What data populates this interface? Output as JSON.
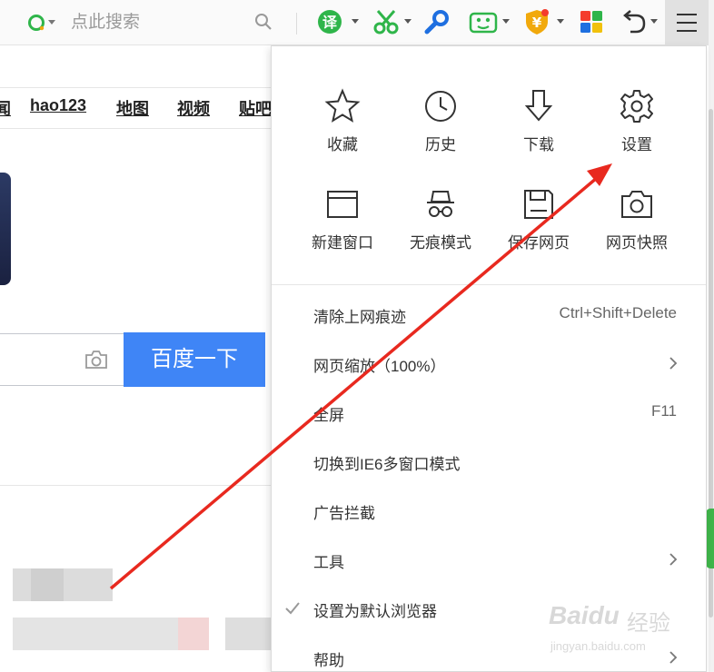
{
  "toolbar": {
    "search_placeholder": "点此搜索",
    "icons": [
      {
        "name": "translate-icon",
        "glyph": "译",
        "color": "#2fb54a"
      },
      {
        "name": "scissors-icon",
        "color": "#2fb54a"
      },
      {
        "name": "magnifier-key-icon",
        "color": "#1e6fe0"
      },
      {
        "name": "gamepad-icon",
        "color": "#2fb54a"
      },
      {
        "name": "yen-shield-icon",
        "glyph": "¥",
        "color": "#f1a90c"
      },
      {
        "name": "apps-grid-icon",
        "colors": [
          "#f43c2c",
          "#2fb54a",
          "#1e6fe0",
          "#f1c10c"
        ]
      },
      {
        "name": "undo-icon",
        "color": "#333333"
      }
    ]
  },
  "page": {
    "nav_links": [
      "闻",
      "hao123",
      "地图",
      "视频",
      "贴吧"
    ],
    "search_button": "百度一下"
  },
  "menu": {
    "tiles": [
      {
        "label": "收藏",
        "icon": "star-icon"
      },
      {
        "label": "历史",
        "icon": "clock-icon"
      },
      {
        "label": "下载",
        "icon": "download-arrow-icon"
      },
      {
        "label": "设置",
        "icon": "gear-icon"
      },
      {
        "label": "新建窗口",
        "icon": "window-icon"
      },
      {
        "label": "无痕模式",
        "icon": "incognito-icon"
      },
      {
        "label": "保存网页",
        "icon": "save-disk-icon"
      },
      {
        "label": "网页快照",
        "icon": "camera-icon"
      }
    ],
    "items": [
      {
        "label": "清除上网痕迹",
        "shortcut": "Ctrl+Shift+Delete",
        "has_submenu": false,
        "checked": false
      },
      {
        "label": "网页缩放（100%）",
        "shortcut": "",
        "has_submenu": true,
        "checked": false
      },
      {
        "label": "全屏",
        "shortcut": "F11",
        "has_submenu": false,
        "checked": false
      },
      {
        "label": "切换到IE6多窗口模式",
        "shortcut": "",
        "has_submenu": false,
        "checked": false
      },
      {
        "label": "广告拦截",
        "shortcut": "",
        "has_submenu": false,
        "checked": false
      },
      {
        "label": "工具",
        "shortcut": "",
        "has_submenu": true,
        "checked": false
      },
      {
        "label": "设置为默认浏览器",
        "shortcut": "",
        "has_submenu": false,
        "checked": true
      },
      {
        "label": "帮助",
        "shortcut": "",
        "has_submenu": true,
        "checked": false
      }
    ]
  },
  "watermark": {
    "brand": "Baidu",
    "cn": "经验",
    "url": "jingyan.baidu.com"
  },
  "colors": {
    "accent_blue": "#3f85f6",
    "annotation_red": "#e8291f"
  }
}
